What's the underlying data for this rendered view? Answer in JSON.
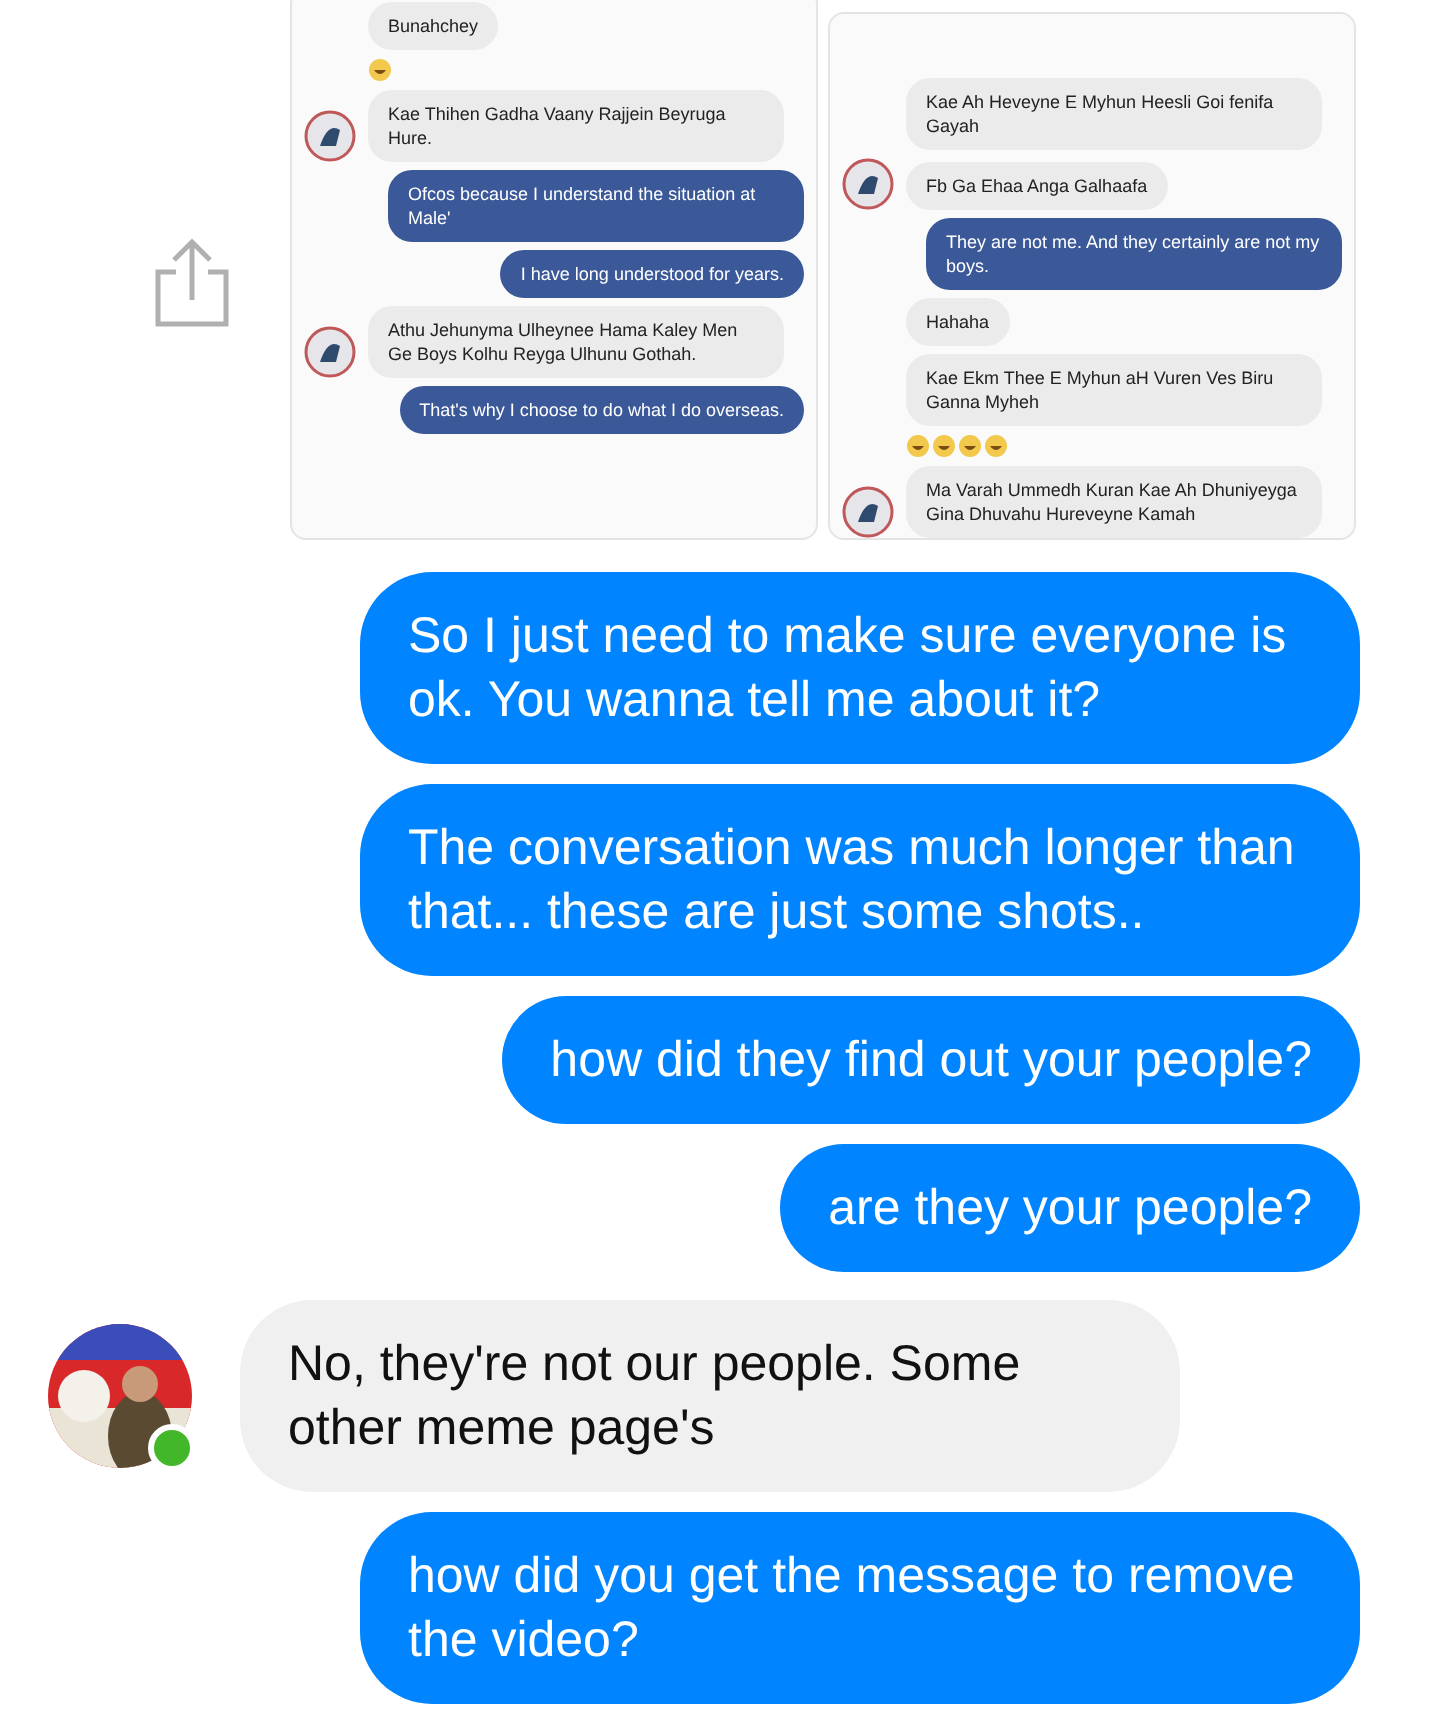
{
  "shared_screenshots": [
    {
      "messages": [
        {
          "kind": "incoming",
          "text": "Bunahchey",
          "avatar": false
        },
        {
          "kind": "emoji",
          "emojis": [
            {
              "kind": "laughing"
            }
          ]
        },
        {
          "kind": "incoming",
          "text": "Kae Thihen Gadha Vaany Rajjein Beyruga Hure.",
          "avatar": true
        },
        {
          "kind": "outgoing",
          "text": "Ofcos because I understand the situation at Male'"
        },
        {
          "kind": "outgoing",
          "text": "I have long understood for years."
        },
        {
          "kind": "incoming",
          "text": "Athu Jehunyma Ulheynee Hama Kaley Men Ge Boys Kolhu Reyga Ulhunu Gothah.",
          "avatar": true
        },
        {
          "kind": "outgoing",
          "text": "That's why I choose to do what I do overseas."
        }
      ]
    },
    {
      "messages": [
        {
          "kind": "incoming",
          "text": "Kae Ah Heveyne E Myhun Heesli Goi fenifa Gayah",
          "avatar": false
        },
        {
          "kind": "incoming",
          "text": "Fb Ga Ehaa Anga Galhaafa",
          "avatar": true
        },
        {
          "kind": "outgoing",
          "text": "They are not me. And they certainly are not my boys."
        },
        {
          "kind": "incoming",
          "text": "Hahaha",
          "avatar": false
        },
        {
          "kind": "incoming",
          "text": "Kae Ekm Thee E Myhun aH Vuren Ves Biru Ganna Myheh",
          "avatar": false
        },
        {
          "kind": "emoji",
          "emojis": [
            {
              "kind": "laughing"
            },
            {
              "kind": "laughing"
            },
            {
              "kind": "laughing"
            },
            {
              "kind": "laughing"
            }
          ]
        },
        {
          "kind": "incoming",
          "text": "Ma Varah Ummedh Kuran Kae Ah Dhuniyeyga Gina Dhuvahu Hureveyne Kamah",
          "avatar": true
        }
      ]
    }
  ],
  "messages": [
    {
      "kind": "outgoing",
      "text": "So I just need to make sure everyone is ok. You wanna tell me about it?"
    },
    {
      "kind": "outgoing",
      "text": "The conversation was much longer than that...  these are just some shots.."
    },
    {
      "kind": "outgoing",
      "text": "how did they find out your people?"
    },
    {
      "kind": "outgoing",
      "text": "are they your people?"
    },
    {
      "kind": "incoming",
      "text": "No, they're not our people. Some other meme page's",
      "avatar": true,
      "online": true
    },
    {
      "kind": "outgoing",
      "text": "how did you get the message to remove the video?"
    }
  ]
}
